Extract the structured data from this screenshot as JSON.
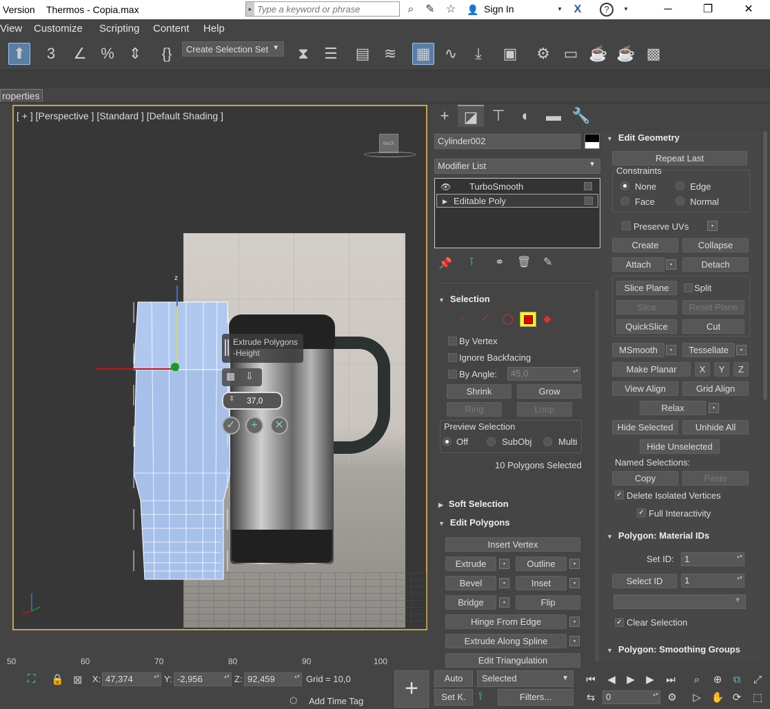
{
  "titlebar": {
    "version_text": "Version",
    "file_name": "Thermos - Copia.max",
    "search_placeholder": "Type a keyword or phrase",
    "sign_in": "Sign In"
  },
  "menu": [
    "View",
    "Customize",
    "Scripting",
    "Content",
    "Help"
  ],
  "toolbar": {
    "selection_set": "Create Selection Set"
  },
  "properties_tab": "roperties",
  "viewport": {
    "label": "[ + ] [Perspective ] [Standard ] [Default Shading ]",
    "viewcube_face": "BACK",
    "gizmo_axis_z": "z",
    "caddy_title": "Extrude Polygons\n-Height",
    "caddy_value": "37,0"
  },
  "command_panel": {
    "object_name": "Cylinder002",
    "modifier_list": "Modifier List",
    "stack": [
      {
        "label": "TurboSmooth"
      },
      {
        "label": "Editable Poly"
      }
    ],
    "selection": {
      "title": "Selection",
      "by_vertex": "By Vertex",
      "ignore_backfacing": "Ignore Backfacing",
      "by_angle": "By Angle:",
      "angle_value": "45,0",
      "shrink": "Shrink",
      "grow": "Grow",
      "ring": "Ring",
      "loop": "Loop",
      "preview_selection": "Preview Selection",
      "off": "Off",
      "subobj": "SubObj",
      "multi": "Multi",
      "status": "10 Polygons Selected"
    },
    "soft_selection": "Soft Selection",
    "edit_polygons": {
      "title": "Edit Polygons",
      "insert_vertex": "Insert Vertex",
      "extrude": "Extrude",
      "outline": "Outline",
      "bevel": "Bevel",
      "inset": "Inset",
      "bridge": "Bridge",
      "flip": "Flip",
      "hinge_from_edge": "Hinge From Edge",
      "extrude_along_spline": "Extrude Along Spline",
      "edit_triangulation": "Edit Triangulation"
    },
    "edit_geometry": {
      "title": "Edit Geometry",
      "repeat_last": "Repeat Last",
      "constraints": "Constraints",
      "none": "None",
      "edge": "Edge",
      "face": "Face",
      "normal": "Normal",
      "preserve_uvs": "Preserve UVs",
      "create": "Create",
      "collapse": "Collapse",
      "attach": "Attach",
      "detach": "Detach",
      "slice_plane": "Slice Plane",
      "split": "Split",
      "slice": "Slice",
      "reset_plane": "Reset Plane",
      "quickslice": "QuickSlice",
      "cut": "Cut",
      "msmooth": "MSmooth",
      "tessellate": "Tessellate",
      "make_planar": "Make Planar",
      "x": "X",
      "y": "Y",
      "z": "Z",
      "view_align": "View Align",
      "grid_align": "Grid Align",
      "relax": "Relax",
      "hide_selected": "Hide Selected",
      "unhide_all": "Unhide All",
      "hide_unselected": "Hide Unselected",
      "named_selections": "Named Selections:",
      "copy": "Copy",
      "paste": "Paste",
      "delete_isolated": "Delete Isolated Vertices",
      "full_interactivity": "Full Interactivity"
    },
    "material_ids": {
      "title": "Polygon: Material IDs",
      "set_id": "Set ID:",
      "set_id_value": "1",
      "select_id": "Select ID",
      "select_id_value": "1",
      "clear_selection": "Clear Selection"
    },
    "smoothing_groups": "Polygon: Smoothing Groups"
  },
  "timeline": {
    "ticks": [
      "50",
      "60",
      "70",
      "80",
      "90",
      "100"
    ]
  },
  "status": {
    "x_label": "X:",
    "x": "47,374",
    "y_label": "Y:",
    "y": "-2,956",
    "z_label": "Z:",
    "z": "92,459",
    "grid": "Grid = 10,0",
    "add_time_tag": "Add Time Tag",
    "auto": "Auto",
    "set_key": "Set K.",
    "selected": "Selected",
    "filters": "Filters...",
    "frame": "0"
  }
}
